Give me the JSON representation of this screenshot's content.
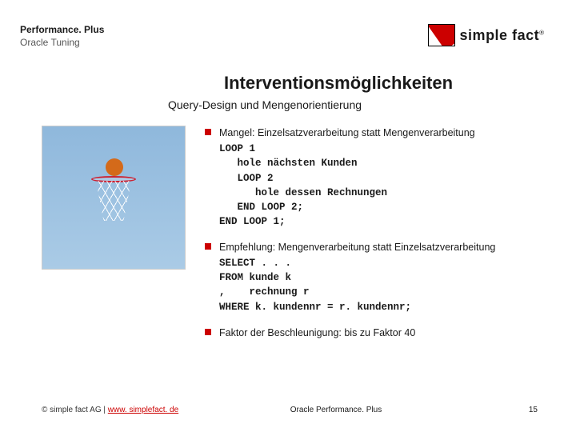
{
  "header": {
    "line1": "Performance. Plus",
    "line2": "Oracle Tuning"
  },
  "brand": {
    "name": "simple fact",
    "registered": "®"
  },
  "title": "Interventionsmöglichkeiten",
  "subtitle": "Query-Design und Mengenorientierung",
  "bullets": {
    "b1": {
      "text": "Mangel: Einzelsatzverarbeitung statt Mengenverarbeitung",
      "code": "LOOP 1\n   hole nächsten Kunden\n   LOOP 2\n      hole dessen Rechnungen\n   END LOOP 2;\nEND LOOP 1;"
    },
    "b2": {
      "text": "Empfehlung: Mengenverarbeitung statt Einzelsatzverarbeitung",
      "code": "SELECT . . .\nFROM kunde k\n,    rechnung r\nWHERE k. kundennr = r. kundennr;"
    },
    "b3": {
      "text": "Faktor der Beschleunigung: bis zu Faktor 40"
    }
  },
  "footer": {
    "copyright": "© simple fact AG",
    "separator": " | ",
    "link_text": "www. simplefact. de",
    "center": "Oracle Performance. Plus",
    "page": "15"
  }
}
